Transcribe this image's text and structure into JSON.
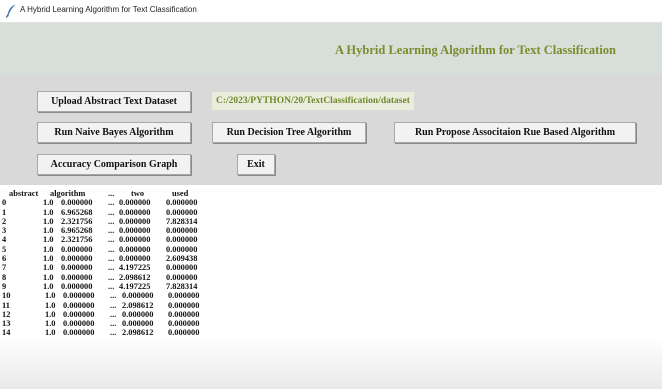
{
  "window": {
    "title": "A Hybrid Learning Algorithm for Text Classification"
  },
  "header": {
    "heading": "A Hybrid Learning Algorithm for Text Classification"
  },
  "controls": {
    "upload_label": "Upload Abstract Text Dataset",
    "dataset_path": "C:/2023/PYTHON/20/TextClassification/dataset",
    "naive_bayes_label": "Run Naive Bayes Algorithm",
    "decision_tree_label": "Run Decision Tree Algorithm",
    "propose_label": "Run Propose Associtaion Rue Based Algorithm",
    "accuracy_graph_label": "Accuracy Comparison Graph",
    "exit_label": "Exit"
  },
  "output": {
    "columns": [
      "abstract",
      "algorithm",
      "...",
      "two",
      "used"
    ],
    "rows": [
      [
        "0",
        "1.0",
        "0.000000",
        "...",
        "0.000000",
        "0.000000"
      ],
      [
        "1",
        "1.0",
        "6.965268",
        "...",
        "0.000000",
        "0.000000"
      ],
      [
        "2",
        "1.0",
        "2.321756",
        "...",
        "0.000000",
        "7.828314"
      ],
      [
        "3",
        "1.0",
        "6.965268",
        "...",
        "0.000000",
        "0.000000"
      ],
      [
        "4",
        "1.0",
        "2.321756",
        "...",
        "0.000000",
        "0.000000"
      ],
      [
        "5",
        "1.0",
        "0.000000",
        "...",
        "0.000000",
        "0.000000"
      ],
      [
        "6",
        "1.0",
        "0.000000",
        "...",
        "0.000000",
        "2.609438"
      ],
      [
        "7",
        "1.0",
        "0.000000",
        "...",
        "4.197225",
        "0.000000"
      ],
      [
        "8",
        "1.0",
        "0.000000",
        "...",
        "2.098612",
        "0.000000"
      ],
      [
        "9",
        "1.0",
        "0.000000",
        "...",
        "4.197225",
        "7.828314"
      ],
      [
        "10",
        "1.0",
        "0.000000",
        "...",
        "0.000000",
        "0.000000"
      ],
      [
        "11",
        "1.0",
        "0.000000",
        "...",
        "2.098612",
        "0.000000"
      ],
      [
        "12",
        "1.0",
        "0.000000",
        "...",
        "0.000000",
        "0.000000"
      ],
      [
        "13",
        "1.0",
        "0.000000",
        "...",
        "0.000000",
        "0.000000"
      ],
      [
        "14",
        "1.0",
        "0.000000",
        "...",
        "2.098612",
        "0.000000"
      ]
    ]
  },
  "colors": {
    "heading": "#7a8c2e",
    "path_text": "#6d8a2c",
    "header_bg": "#d8dfd8",
    "controls_bg": "#d9d9d9"
  },
  "icons": {
    "app": "feather-icon"
  }
}
